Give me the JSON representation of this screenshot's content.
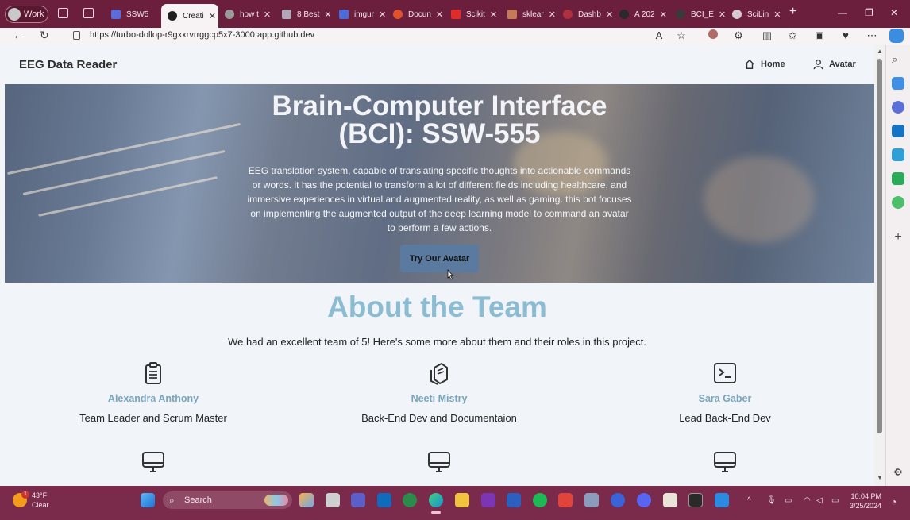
{
  "browser": {
    "profile_label": "Work",
    "tabs": [
      {
        "title": "SSW5",
        "color": "#5b6bd8"
      },
      {
        "title": "Creati",
        "color": "#1f1f1f"
      },
      {
        "title": "how t",
        "color": "#9b9b9b"
      },
      {
        "title": "8 Best",
        "color": "#b0a6b5"
      },
      {
        "title": "imgur",
        "color": "#4c6bd6"
      },
      {
        "title": "Docun",
        "color": "#e0512d"
      },
      {
        "title": "Scikit",
        "color": "#e02b2b"
      },
      {
        "title": "sklear",
        "color": "#c77a5a"
      },
      {
        "title": "Dashb",
        "color": "#b03040"
      },
      {
        "title": "A 202",
        "color": "#2a2a2a"
      },
      {
        "title": "BCI_E",
        "color": "#3a3a3a"
      },
      {
        "title": "SciLin",
        "color": "#d8c8d0"
      }
    ],
    "url": "https://turbo-dollop-r9gxxrvrrggcp5x7-3000.app.github.dev"
  },
  "site": {
    "brand": "EEG Data Reader",
    "nav": {
      "home": "Home",
      "avatar": "Avatar"
    }
  },
  "hero": {
    "title": "Brain-Computer Interface (BCI): SSW-555",
    "text": "EEG translation system, capable of translating specific thoughts into actionable commands or words. it has the potential to transform a lot of different fields including healthcare, and immersive experiences in virtual and augmented reality, as well as gaming. this bot focuses on implementing the augmented output of the deep learning model to command an avatar to perform a few actions.",
    "cta": "Try Our Avatar"
  },
  "about": {
    "title": "About the Team",
    "text": "We had an excellent team of 5! Here's some more about them and their roles in this project.",
    "members": [
      {
        "name": "Alexandra Anthony",
        "role": "Team Leader and Scrum Master",
        "icon": "clipboard-icon"
      },
      {
        "name": "Neeti Mistry",
        "role": "Back-End Dev and Documentaion",
        "icon": "documents-icon"
      },
      {
        "name": "Sara Gaber",
        "role": "Lead Back-End Dev",
        "icon": "terminal-icon"
      }
    ]
  },
  "taskbar": {
    "weather": {
      "temp": "43°F",
      "condition": "Clear",
      "badge": "1"
    },
    "search_label": "Search",
    "time": "10:04 PM",
    "date": "3/25/2024"
  }
}
